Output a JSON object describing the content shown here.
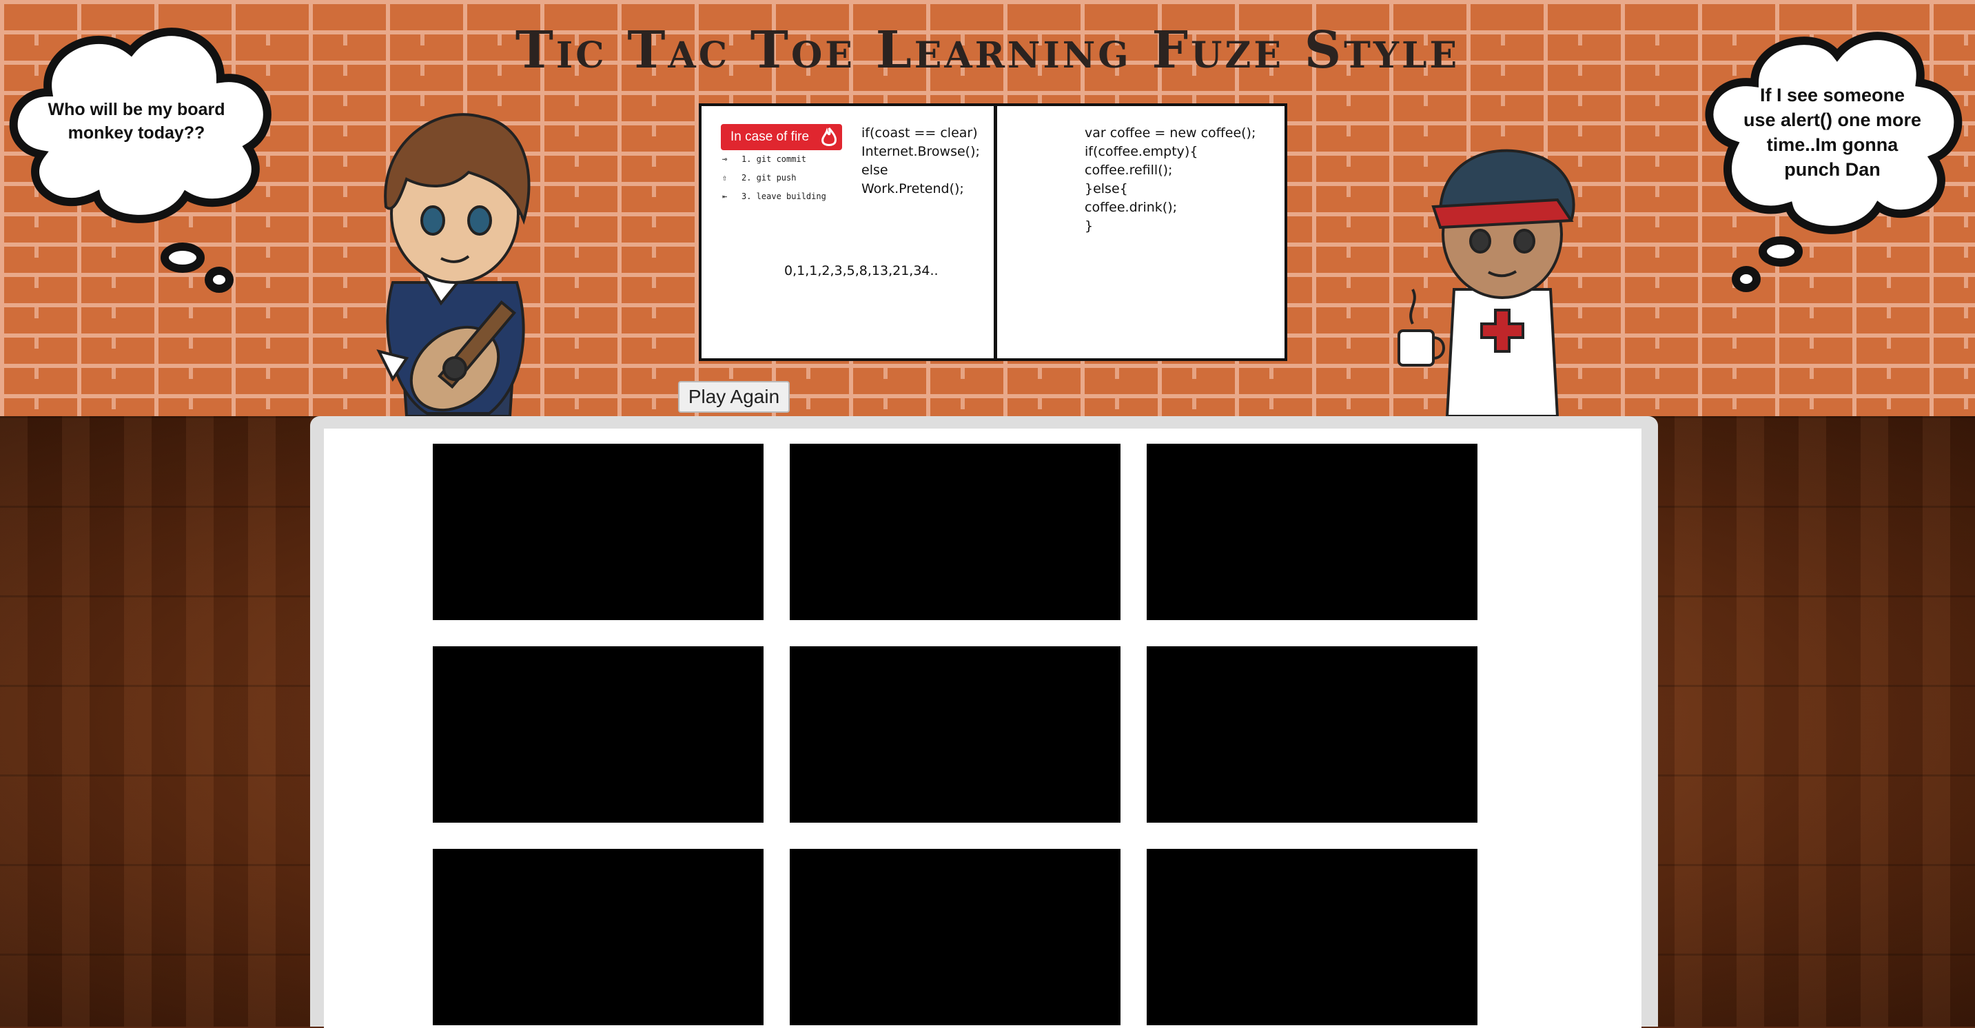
{
  "header": {
    "title": "Tic Tac Toe Learning Fuze Style"
  },
  "left_bubble": {
    "text_line1": "Who will be my board",
    "text_line2": "monkey today??"
  },
  "right_bubble": {
    "text_line1": "If I see someone",
    "text_line2": "use alert() one more",
    "text_line3": "time..Im gonna",
    "text_line4": "punch Dan"
  },
  "whiteboard": {
    "left": {
      "badge": "In case of fire",
      "steps": [
        "1. git commit",
        "2. git push",
        "3. leave building"
      ],
      "code_lines": [
        "if(coast == clear)",
        "Internet.Browse();",
        "else",
        "Work.Pretend();"
      ],
      "sequence": "0,1,1,2,3,5,8,13,21,34.."
    },
    "right": {
      "code_lines": [
        "var coffee = new coffee();",
        "if(coffee.empty){",
        "coffee.refill();",
        "}else{",
        "coffee.drink();",
        "}"
      ]
    }
  },
  "controls": {
    "play_again_label": "Play Again"
  },
  "game_board": {
    "cells": [
      "",
      "",
      "",
      "",
      "",
      "",
      "",
      "",
      ""
    ]
  },
  "colors": {
    "brick": "#d06d3a",
    "mortar": "#e9a98a",
    "wood": "#6b3414",
    "cell": "#000000",
    "fire_badge": "#e0262f"
  }
}
